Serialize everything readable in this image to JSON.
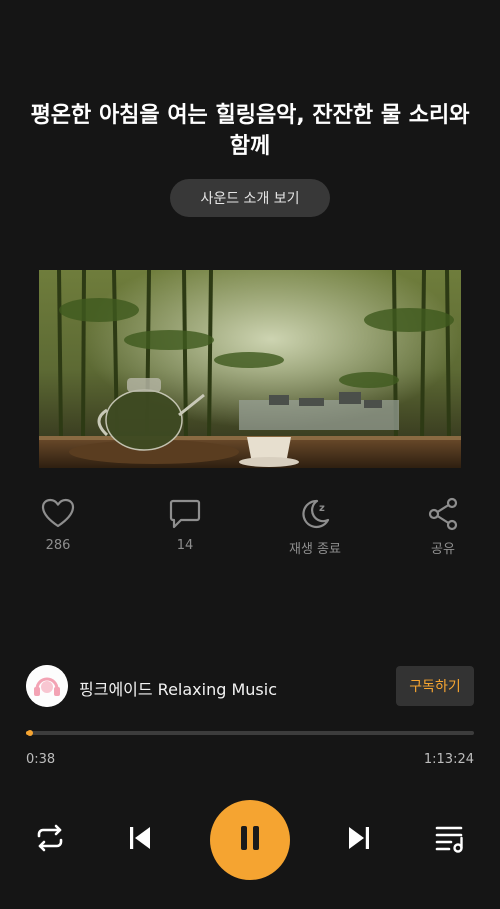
{
  "header": {
    "title": "평온한 아침을 여는 힐링음악, 잔잔한 물 소리와 함께",
    "intro_button": "사운드 소개 보기"
  },
  "artwork": {
    "description_icon": "bamboo-tea-scene"
  },
  "actions": [
    {
      "icon": "heart-icon",
      "label": "286"
    },
    {
      "icon": "comment-icon",
      "label": "14"
    },
    {
      "icon": "sleep-timer-icon",
      "label": "재생 종료"
    },
    {
      "icon": "share-icon",
      "label": "공유"
    }
  ],
  "channel": {
    "name": "핑크에이드 Relaxing Music",
    "subscribe_label": "구독하기"
  },
  "player": {
    "current_time": "0:38",
    "total_time": "1:13:24",
    "progress": 0.0085,
    "state": "playing"
  },
  "colors": {
    "accent": "#f5a431",
    "background": "#151515"
  }
}
